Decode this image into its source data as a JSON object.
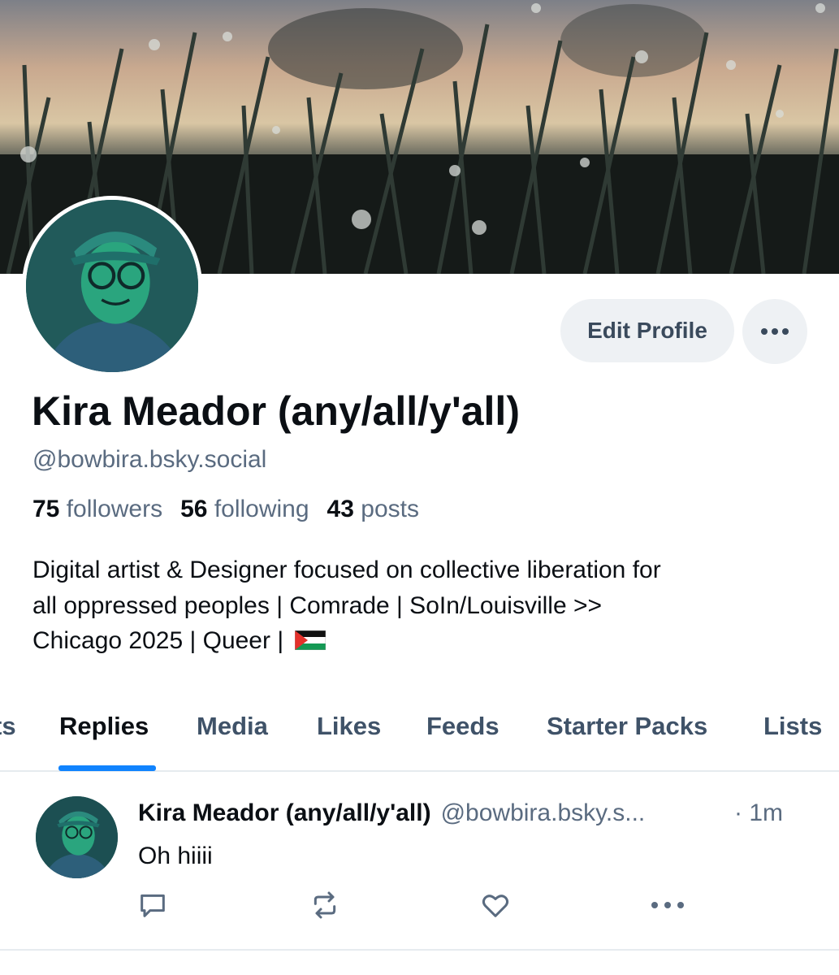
{
  "profile": {
    "display_name": "Kira Meador (any/all/y'all)",
    "handle": "@bowbira.bsky.social",
    "edit_label": "Edit Profile",
    "followers_count": "75",
    "followers_label": "followers",
    "following_count": "56",
    "following_label": "following",
    "posts_count": "43",
    "posts_label": "posts",
    "bio_line1": "Digital artist & Designer focused on collective liberation for",
    "bio_line2": "all oppressed peoples | Comrade | SoIn/Louisville >>",
    "bio_line3": "Chicago 2025 |  Queer |",
    "bio_flag_icon": "palestine-flag-icon"
  },
  "tabs": [
    {
      "label": "ts"
    },
    {
      "label": "Replies"
    },
    {
      "label": "Media"
    },
    {
      "label": "Likes"
    },
    {
      "label": "Feeds"
    },
    {
      "label": "Starter Packs"
    },
    {
      "label": "Lists"
    }
  ],
  "active_tab": "Replies",
  "post": {
    "author": "Kira Meador (any/all/y'all)",
    "handle": "@bowbira.bsky.s...",
    "time": "· 1m",
    "text": "Oh hiiii",
    "icons": [
      "reply-icon",
      "repost-icon",
      "like-icon",
      "more-icon"
    ]
  },
  "colors": {
    "accent": "#1083fe",
    "muted_text": "#5a6b80",
    "button_bg": "#eef1f4"
  }
}
